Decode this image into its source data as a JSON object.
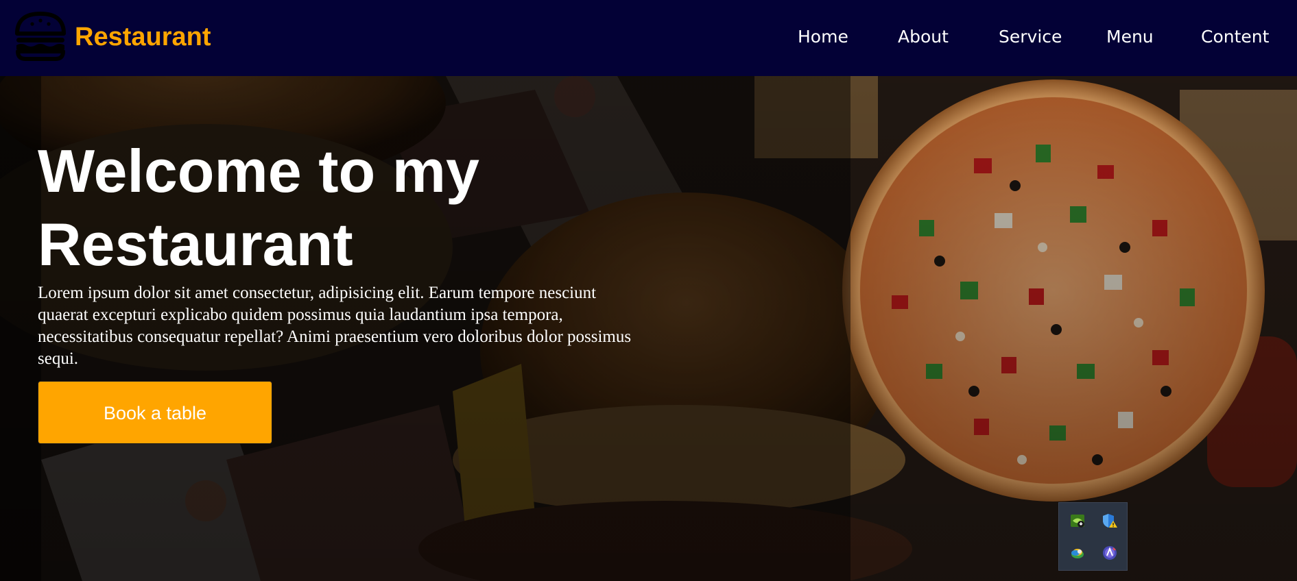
{
  "header": {
    "logo_icon": "burger-icon",
    "logo_text": "Restaurant",
    "nav": [
      {
        "label": "Home"
      },
      {
        "label": "About"
      },
      {
        "label": "Service"
      },
      {
        "label": "Menu"
      },
      {
        "label": "Content"
      }
    ]
  },
  "hero": {
    "title": "Welcome to my Restaurant",
    "text": "Lorem ipsum dolor sit amet consectetur, adipisicing elit. Earum tempore nesciunt quaerat excepturi explicabo quidem possimus quia laudantium ipsa tempora, necessitatibus consequatur repellat? Animi praesentium vero doloribus dolor possimus sequi.",
    "button_label": "Book a table",
    "background_image": "burgers-and-fries-photo",
    "feature_image": "pizza-image"
  },
  "tray": {
    "icons": [
      "nvidia-update-icon",
      "security-warning-icon",
      "network-globe-icon",
      "app-icon"
    ]
  },
  "colors": {
    "header_bg": "#030136",
    "accent": "#ffa500",
    "text": "#ffffff"
  }
}
